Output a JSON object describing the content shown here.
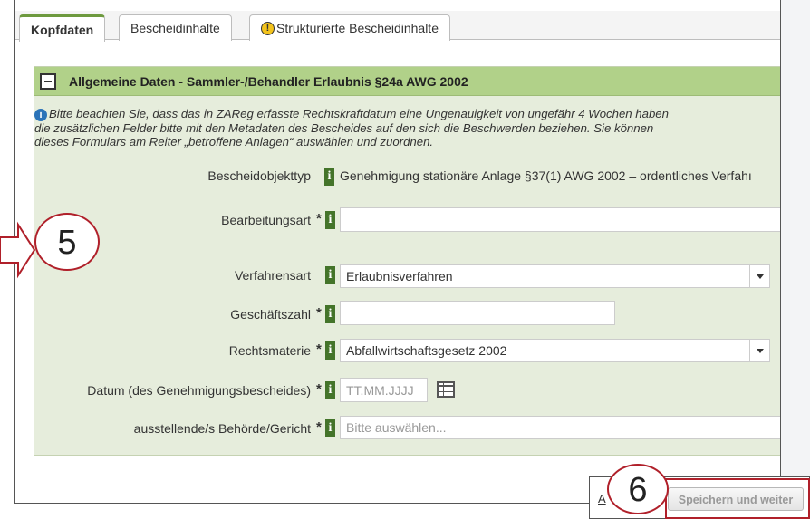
{
  "tabs": [
    {
      "label": "Kopfdaten",
      "active": true
    },
    {
      "label": "Bescheidinhalte",
      "active": false
    },
    {
      "label": "Strukturierte Bescheidinhalte",
      "active": false,
      "icon": "warning-icon"
    }
  ],
  "panel": {
    "title": "Allgemeine Daten - Sammler-/Behandler Erlaubnis §24a AWG 2002",
    "info_lines": [
      "Bitte beachten Sie, dass das in ZAReg erfasste Rechtskraftdatum eine Ungenauigkeit von ungefähr 4 Wochen haben",
      "die zusätzlichen Felder bitte mit den Metadaten des Bescheides auf den sich die Beschwerden beziehen. Sie können",
      "dieses Formulars am Reiter „betroffene Anlagen“ auswählen und zuordnen."
    ]
  },
  "fields": {
    "bescheidobjekttyp": {
      "label": "Bescheidobjekttyp",
      "value": "Genehmigung stationäre Anlage §37(1) AWG 2002 – ordentliches Verfahı"
    },
    "bearbeitungsart": {
      "label": "Bearbeitungsart",
      "required_mark": "*",
      "value": ""
    },
    "verfahrensart": {
      "label": "Verfahrensart",
      "value": "Erlaubnisverfahren"
    },
    "geschaeftszahl": {
      "label": "Geschäftszahl",
      "required_mark": "*",
      "value": ""
    },
    "rechtsmaterie": {
      "label": "Rechtsmaterie",
      "required_mark": "*",
      "value": "Abfallwirtschaftsgesetz 2002"
    },
    "datum": {
      "label": "Datum (des Genehmigungsbescheides)",
      "required_mark": "*",
      "placeholder": "TT.MM.JJJJ"
    },
    "behoerde": {
      "label": "ausstellende/s Behörde/Gericht",
      "required_mark": "*",
      "placeholder": "Bitte auswählen..."
    }
  },
  "help_glyph": "i",
  "info_glyph": "i",
  "warning_glyph": "!",
  "bottom": {
    "link_fragment": "A",
    "save_button": "Speichern und weiter"
  },
  "annotations": {
    "marker_5": "5",
    "marker_6": "6",
    "color": "#b0202a"
  },
  "colors": {
    "panel_header": "#b1d189",
    "panel_body": "#e6eddc",
    "help_icon": "#44742a",
    "active_tab_accent": "#6e9a3f"
  }
}
